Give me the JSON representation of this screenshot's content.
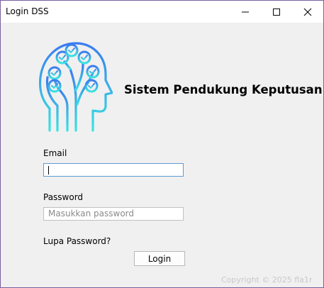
{
  "window": {
    "title": "Login DSS"
  },
  "header": {
    "app_title": "Sistem Pendukung Keputusan",
    "logo_icon": "head-circuit-icon"
  },
  "form": {
    "email_label": "Email",
    "email_value": "",
    "password_label": "Password",
    "password_placeholder": "Masukkan password",
    "forgot_label": "Lupa Password?",
    "login_label": "Login"
  },
  "footer": {
    "copyright": "Copyright © 2025 fla1r"
  },
  "colors": {
    "logo_gradient_top": "#3b7bf0",
    "logo_gradient_bottom": "#3be3e0",
    "focus_border": "#5b9bd5"
  }
}
